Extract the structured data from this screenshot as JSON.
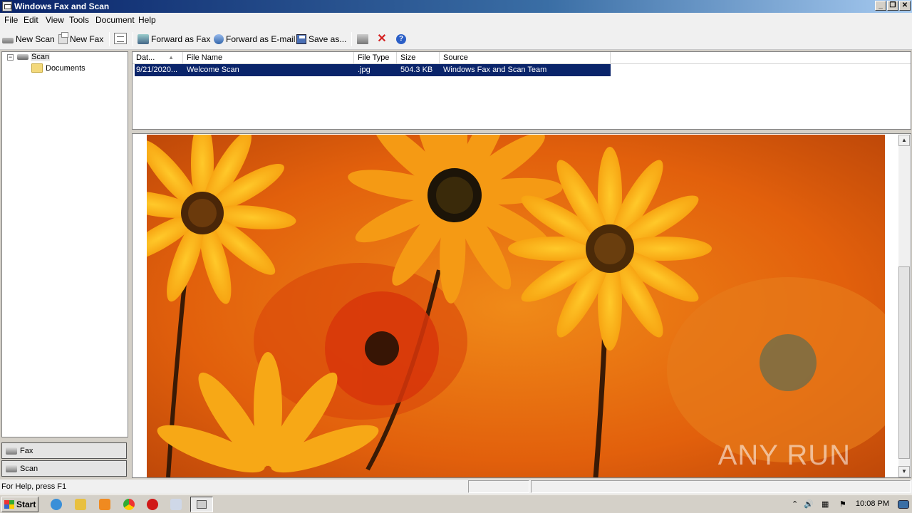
{
  "window": {
    "title": "Windows Fax and Scan"
  },
  "menu": [
    "File",
    "Edit",
    "View",
    "Tools",
    "Document",
    "Help"
  ],
  "toolbar": {
    "new_scan": "New Scan",
    "new_fax": "New Fax",
    "forward_fax": "Forward as Fax",
    "forward_email": "Forward as E-mail",
    "save_as": "Save as..."
  },
  "tree": {
    "root": "Scan",
    "child": "Documents"
  },
  "list": {
    "columns": [
      "Dat...",
      "File Name",
      "File Type",
      "Size",
      "Source"
    ],
    "rows": [
      {
        "date": "9/21/2020...",
        "file_name": "Welcome Scan",
        "file_type": ".jpg",
        "size": "504.3 KB",
        "source": "Windows Fax and Scan Team"
      }
    ]
  },
  "nav": {
    "fax": "Fax",
    "scan": "Scan"
  },
  "status": {
    "text": "For Help, press F1"
  },
  "watermark": "ANY RUN",
  "taskbar": {
    "start": "Start",
    "clock": "10:08 PM"
  },
  "colors": {
    "selection": "#0a246a",
    "title_start": "#0a246a",
    "title_end": "#a6caf0"
  },
  "icons": [
    "scanner-icon",
    "fax-icon",
    "view-icon",
    "forward-fax-icon",
    "email-icon",
    "save-icon",
    "print-icon",
    "delete-icon",
    "help-icon",
    "folder-icon"
  ]
}
